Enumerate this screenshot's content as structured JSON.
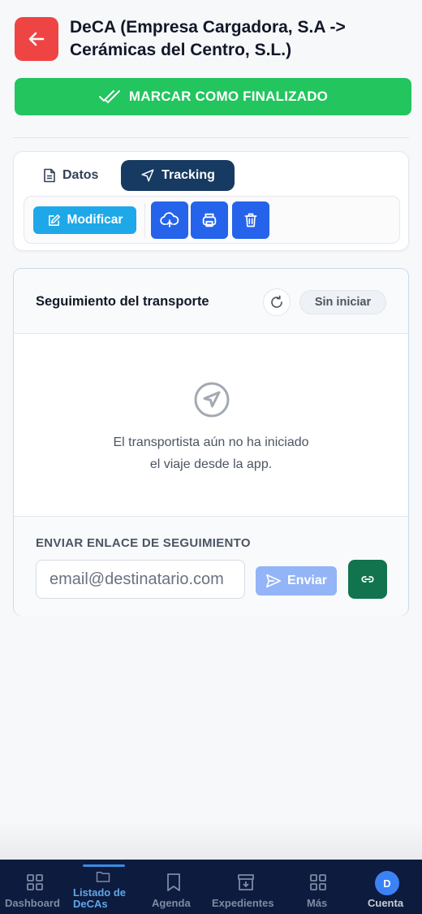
{
  "header": {
    "title": "DeCA (Empresa Cargadora, S.A -> Cerámicas del Centro, S.L.)",
    "back_icon": "arrow-left-icon"
  },
  "actions": {
    "finish_label": "MARCAR COMO FINALIZADO"
  },
  "tabs": [
    {
      "label": "Datos",
      "icon": "document-icon",
      "active": false
    },
    {
      "label": "Tracking",
      "icon": "navigation-icon",
      "active": true
    }
  ],
  "toolbar": {
    "modify_label": "Modificar",
    "buttons": [
      "cloud-upload-icon",
      "printer-icon",
      "trash-icon"
    ]
  },
  "tracking": {
    "title": "Seguimiento del transporte",
    "status": "Sin iniciar",
    "empty_line1": "El transportista aún no ha iniciado",
    "empty_line2": "el viaje desde la app.",
    "send_label": "ENVIAR ENLACE DE SEGUIMIENTO",
    "email_placeholder": "email@destinatario.com",
    "send_button": "Enviar"
  },
  "nav": [
    {
      "label": "Dashboard",
      "icon": "grid-icon"
    },
    {
      "label": "Listado de DeCAs",
      "icon": "folder-icon",
      "active": true
    },
    {
      "label": "Agenda",
      "icon": "bookmark-icon"
    },
    {
      "label": "Expedientes",
      "icon": "archive-icon"
    },
    {
      "label": "Más",
      "icon": "grid-icon"
    },
    {
      "label": "Cuenta",
      "icon": "avatar-icon",
      "avatar_initial": "D"
    }
  ],
  "colors": {
    "back": "#ef4444",
    "finish": "#22c55e",
    "tab_active": "#163a61",
    "modify": "#1ea8e9",
    "toolbar_buttons": "#2563eb",
    "send_disabled": "#93b4f6",
    "link_button": "#12734f",
    "nav_bg": "#0d1b3e",
    "nav_active": "#5ea7ea"
  }
}
